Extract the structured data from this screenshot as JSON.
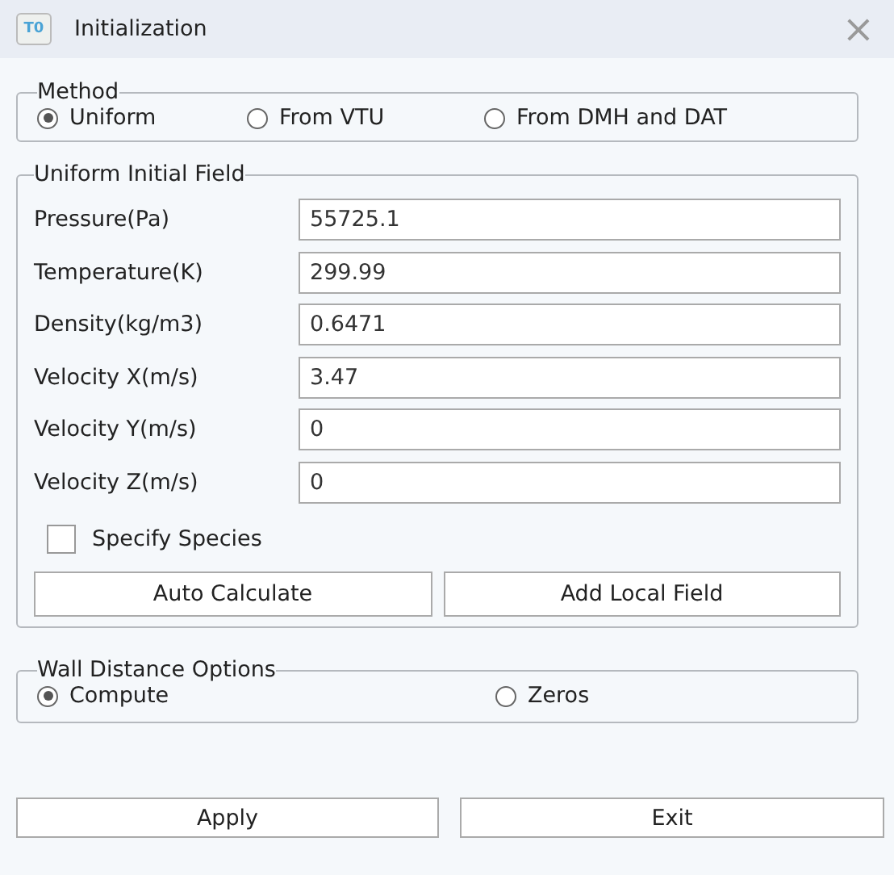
{
  "window": {
    "icon_text": "T0",
    "title": "Initialization",
    "close": "×"
  },
  "method": {
    "title": "Method",
    "options": [
      {
        "label": "Uniform",
        "selected": true
      },
      {
        "label": "From VTU",
        "selected": false
      },
      {
        "label": "From DMH and DAT",
        "selected": false
      }
    ]
  },
  "uniform_field": {
    "title": "Uniform Initial Field",
    "fields": [
      {
        "label": "Pressure(Pa)",
        "value": "55725.1"
      },
      {
        "label": "Temperature(K)",
        "value": "299.99"
      },
      {
        "label": "Density(kg/m3)",
        "value": "0.6471"
      },
      {
        "label": "Velocity X(m/s)",
        "value": "3.47"
      },
      {
        "label": "Velocity Y(m/s)",
        "value": "0"
      },
      {
        "label": "Velocity Z(m/s)",
        "value": "0"
      }
    ],
    "specify_species": {
      "label": "Specify Species",
      "checked": false
    },
    "buttons": [
      "Auto Calculate",
      "Add Local Field"
    ]
  },
  "wall_distance": {
    "title": "Wall Distance Options",
    "options": [
      {
        "label": "Compute",
        "selected": true
      },
      {
        "label": "Zeros",
        "selected": false
      }
    ]
  },
  "buttons": [
    "Apply",
    "Exit"
  ]
}
